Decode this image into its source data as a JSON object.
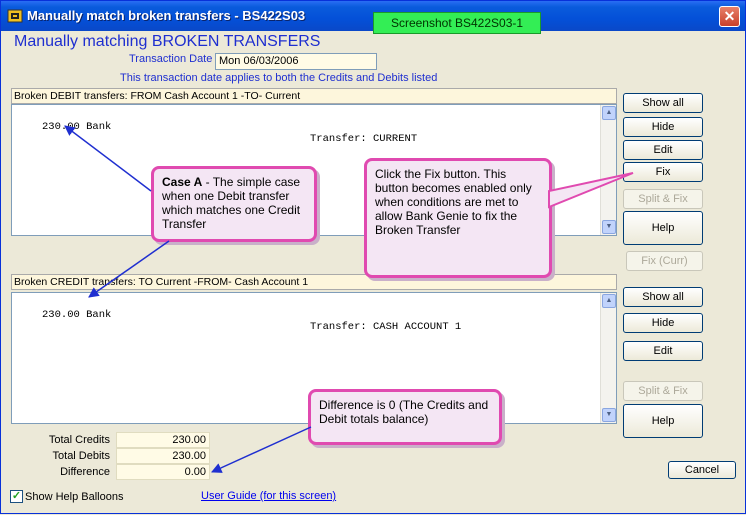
{
  "window": {
    "title": "Manually match broken transfers - BS422S03",
    "screenshot_label": "Screenshot BS422S03-1",
    "close_glyph": "✕"
  },
  "header": {
    "heading": "Manually matching BROKEN TRANSFERS",
    "transaction_date_label": "Transaction Date",
    "transaction_date_value": "Mon  06/03/2006",
    "date_note": "This transaction date applies to both the Credits and Debits listed"
  },
  "debit": {
    "label": "Broken DEBIT transfers: FROM Cash Account 1 -TO- Current",
    "rows": [
      {
        "amount": "230.00 Bank",
        "description": "Transfer: CURRENT"
      }
    ]
  },
  "credit": {
    "label": "Broken CREDIT transfers: TO Current -FROM- Cash Account 1",
    "rows": [
      {
        "amount": "230.00 Bank",
        "description": "Transfer: CASH ACCOUNT 1"
      }
    ]
  },
  "buttons": {
    "show_all_1": "Show all",
    "hide_1": "Hide",
    "edit_1": "Edit",
    "fix": "Fix",
    "split_fix_1": "Split & Fix",
    "help_1": "Help",
    "fix_curr": "Fix (Curr)",
    "show_all_2": "Show all",
    "hide_2": "Hide",
    "edit_2": "Edit",
    "split_fix_2": "Split & Fix",
    "help_2": "Help",
    "cancel": "Cancel"
  },
  "totals": {
    "credits_label": "Total Credits",
    "credits_value": "230.00",
    "debits_label": "Total Debits",
    "debits_value": "230.00",
    "difference_label": "Difference",
    "difference_value": "0.00"
  },
  "footer": {
    "show_help_balloons": "Show Help Balloons",
    "checkbox_glyph": "✓",
    "user_guide": "User Guide (for this screen)"
  },
  "balloons": {
    "case_a_bold": "Case A",
    "case_a_text": " - The simple case when one Debit transfer which matches one Credit Transfer",
    "fix_text": "Click the Fix button. This button becomes enabled only when conditions are met to allow Bank Genie to fix the Broken Transfer",
    "difference_text": "Difference is 0 (The Credits and Debit totals balance)"
  },
  "scroll": {
    "up": "▲",
    "down": "▼"
  },
  "colors": {
    "title_bar": "#0450d8",
    "heading_blue": "#1f2fd0",
    "balloon_border": "#e04ab0",
    "screenshot_label_bg": "#33ee55",
    "arrow": "#1f2fd0"
  }
}
